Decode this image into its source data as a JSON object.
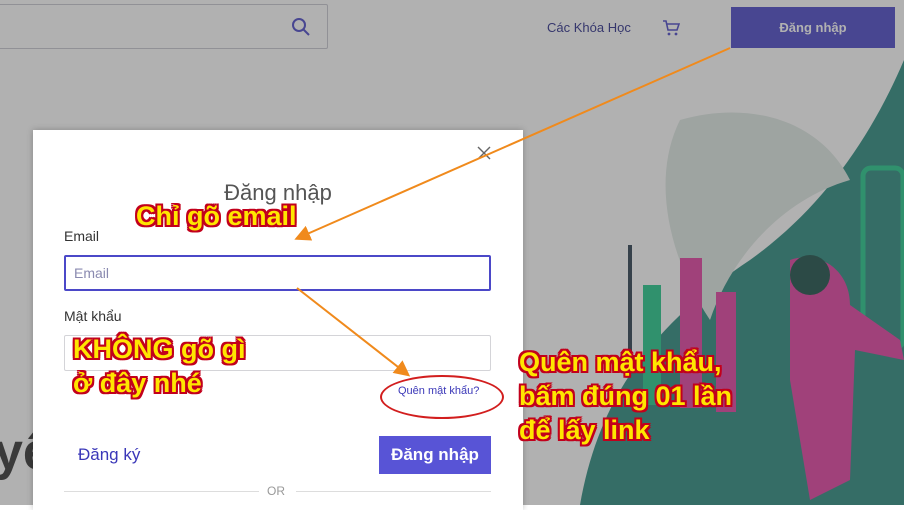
{
  "header": {
    "nav_courses": "Các Khóa Học",
    "login_button": "Đăng nhập",
    "icons": [
      "search-icon",
      "cart-icon"
    ]
  },
  "hero": {
    "partial_text": "yể"
  },
  "modal": {
    "title": "Đăng nhập",
    "email_label": "Email",
    "email_placeholder": "Email",
    "password_label": "Mật khẩu",
    "forgot_link": "Quên mật khẩu?",
    "register_link": "Đăng ký",
    "login_button": "Đăng nhập",
    "or_text": "OR"
  },
  "annotations": {
    "email_note": "Chỉ gõ email",
    "password_note_line1": "KHÔNG gõ gì",
    "password_note_line2": "ở đây nhé",
    "forgot_note_line1": "Quên mật khẩu,",
    "forgot_note_line2": "bấm đúng 01 lần",
    "forgot_note_line3": "để lấy link",
    "text_color": "#ffe600",
    "outline_color": "#c2001c",
    "arrow_color": "#f08a1c"
  },
  "colors": {
    "brand": "#4b48c8",
    "button": "#5854d6",
    "hero_teal": "#2a8a7e",
    "hero_green": "#22c98a",
    "hero_pink": "#e23fa0"
  }
}
